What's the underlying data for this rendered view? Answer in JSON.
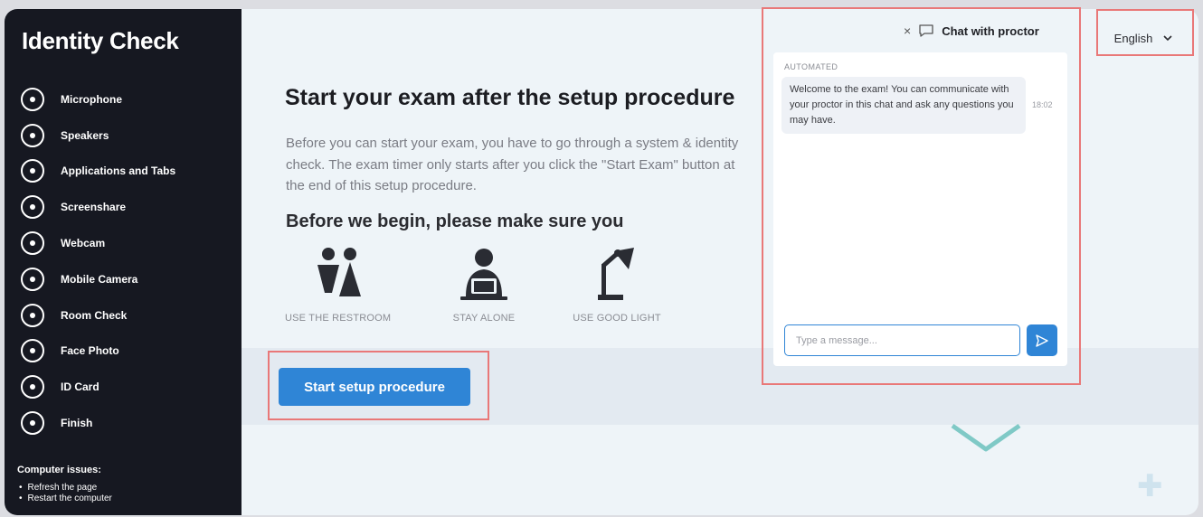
{
  "sidebar": {
    "title": "Identity Check",
    "steps": [
      {
        "label": "Microphone"
      },
      {
        "label": "Speakers"
      },
      {
        "label": "Applications and Tabs"
      },
      {
        "label": "Screenshare"
      },
      {
        "label": "Webcam"
      },
      {
        "label": "Mobile Camera"
      },
      {
        "label": "Room Check"
      },
      {
        "label": "Face Photo"
      },
      {
        "label": "ID Card"
      },
      {
        "label": "Finish"
      }
    ],
    "issues": {
      "title": "Computer issues:",
      "items": [
        "Refresh the page",
        "Restart the computer"
      ]
    }
  },
  "main": {
    "title": "Start your exam after the setup procedure",
    "description": "Before you can start your exam, you have to go through a system & identity check. The exam timer only starts after you click the \"Start Exam\" button at the end of this setup procedure.",
    "subheading": "Before we begin, please make sure you",
    "prep_items": [
      {
        "label": "USE THE RESTROOM",
        "icon": "restroom-icon"
      },
      {
        "label": "STAY ALONE",
        "icon": "person-laptop-icon"
      },
      {
        "label": "USE GOOD LIGHT",
        "icon": "desk-lamp-icon"
      }
    ],
    "start_button": "Start setup procedure"
  },
  "chat": {
    "close": "×",
    "title": "Chat with proctor",
    "tag": "AUTOMATED",
    "message": "Welcome to the exam! You can communicate with your proctor in this chat and ask any questions you may have.",
    "time": "18:02",
    "input_placeholder": "Type a message..."
  },
  "language": {
    "selected": "English"
  },
  "colors": {
    "sidebar_bg": "#161821",
    "accent": "#2f85d6",
    "highlight": "#e97878"
  }
}
